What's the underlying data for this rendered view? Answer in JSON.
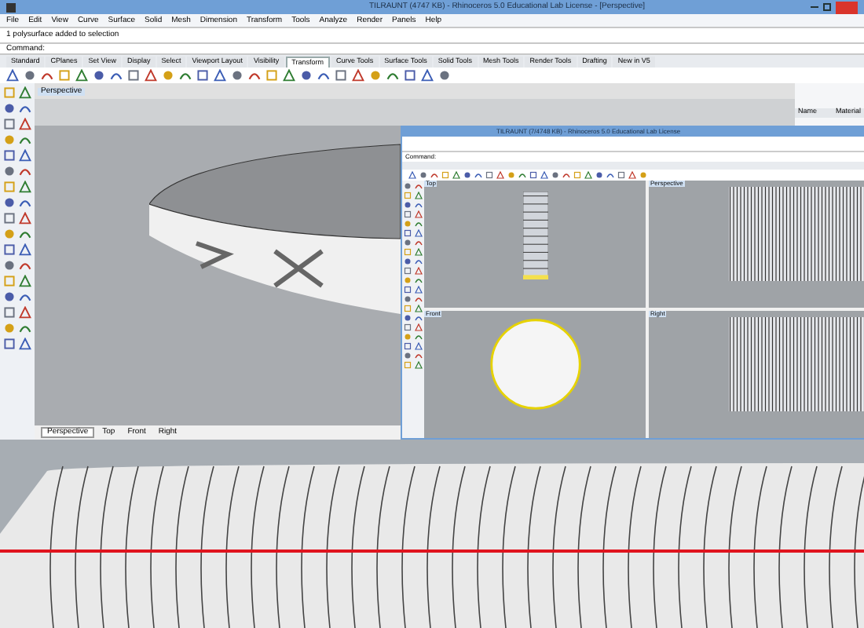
{
  "window": {
    "title": "TILRAUNT (4747 KB) - Rhinoceros 5.0 Educational Lab License - [Perspective]"
  },
  "menu": [
    "File",
    "Edit",
    "View",
    "Curve",
    "Surface",
    "Solid",
    "Mesh",
    "Dimension",
    "Transform",
    "Tools",
    "Analyze",
    "Render",
    "Panels",
    "Help"
  ],
  "command_history": "1 polysurface added to selection",
  "command_prompt": "Command:",
  "toolbar_tabs": [
    {
      "label": "Standard",
      "selected": false
    },
    {
      "label": "CPlanes",
      "selected": false
    },
    {
      "label": "Set View",
      "selected": false
    },
    {
      "label": "Display",
      "selected": false
    },
    {
      "label": "Select",
      "selected": false
    },
    {
      "label": "Viewport Layout",
      "selected": false
    },
    {
      "label": "Visibility",
      "selected": false
    },
    {
      "label": "Transform",
      "selected": true
    },
    {
      "label": "Curve Tools",
      "selected": false
    },
    {
      "label": "Surface Tools",
      "selected": false
    },
    {
      "label": "Solid Tools",
      "selected": false
    },
    {
      "label": "Mesh Tools",
      "selected": false
    },
    {
      "label": "Render Tools",
      "selected": false
    },
    {
      "label": "Drafting",
      "selected": false
    },
    {
      "label": "New in V5",
      "selected": false
    }
  ],
  "viewport": {
    "label": "Perspective",
    "tabs": [
      {
        "label": "Perspective",
        "selected": true
      },
      {
        "label": "Top",
        "selected": false
      },
      {
        "label": "Front",
        "selected": false
      },
      {
        "label": "Right",
        "selected": false
      }
    ]
  },
  "panel": {
    "columns": [
      "Name",
      "Material"
    ]
  },
  "inner_window": {
    "title": "TILRAUNT (7/4748 KB) - Rhinoceros 5.0 Educational Lab License",
    "command_prompt": "Command:",
    "viewports": [
      {
        "label": "Top",
        "kind": "column"
      },
      {
        "label": "Perspective",
        "kind": "ribbed"
      },
      {
        "label": "Front",
        "kind": "disc"
      },
      {
        "label": "Right",
        "kind": "ribbed"
      }
    ]
  }
}
